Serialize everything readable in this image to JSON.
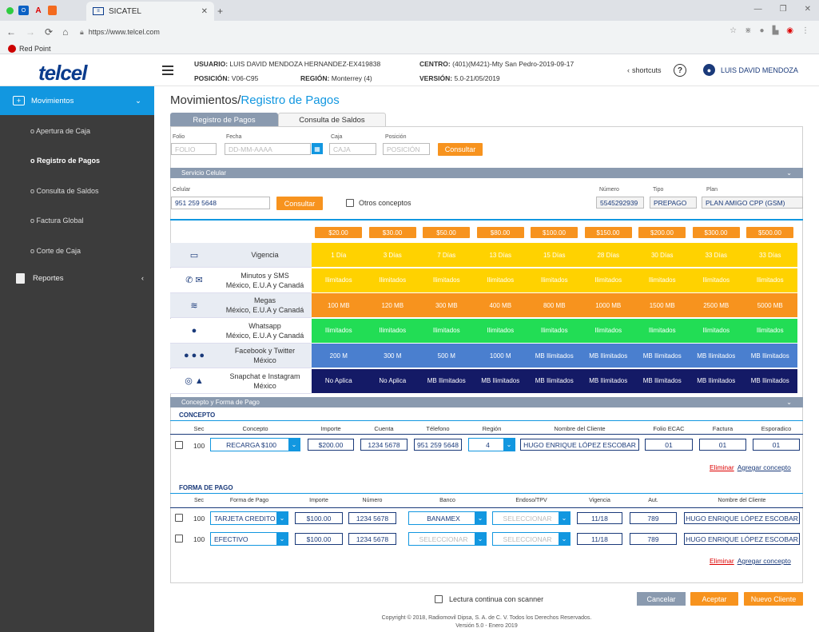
{
  "browser": {
    "tab_title": "SICATEL",
    "url": "https://www.telcel.com",
    "bookmark": "Red Point"
  },
  "header": {
    "logo": "telcel",
    "usuario_label": "USUARIO:",
    "usuario": "LUIS DAVID MENDOZA HERNANDEZ-EX419838",
    "posicion_label": "POSICIÓN:",
    "posicion": "V06-C95",
    "region_label": "REGIÓN:",
    "region": "Monterrey (4)",
    "centro_label": "CENTRO:",
    "centro": "(401)(M421)-Mty San Pedro-2019-09-17",
    "version_label": "VERSIÓN:",
    "version": "5.0-21/05/2019",
    "shortcuts": "shortcuts",
    "user_name": "LUIS DAVID MENDOZA"
  },
  "sidebar": {
    "movimientos": "Movimientos",
    "items": [
      "o Apertura de Caja",
      "o Registro de Pagos",
      "o Consulta de Saldos",
      "o Factura Global",
      "o Corte de Caja"
    ],
    "reportes": "Reportes"
  },
  "page": {
    "title_main": "Movimientos/",
    "title_sub": "Registro de Pagos",
    "tab_registro": "Registro de Pagos",
    "tab_consulta": "Consulta de Saldos"
  },
  "filters": {
    "folio_label": "Folio",
    "folio_ph": "FOLIO",
    "fecha_label": "Fecha",
    "fecha_ph": "DD-MM-AAAA",
    "caja_label": "Caja",
    "caja_ph": "CAJA",
    "posicion_label": "Posición",
    "posicion_ph": "POSICIÓN",
    "consultar": "Consultar"
  },
  "servicio": {
    "title": "Servicio Celular",
    "celular_label": "Celular",
    "celular": "951 259 5648",
    "consultar": "Consultar",
    "otros": "Otros conceptos",
    "numero_label": "Número",
    "numero": "5545292939",
    "tipo_label": "Tipo",
    "tipo": "PREPAGO",
    "plan_label": "Plan",
    "plan": "PLAN AMIGO CPP (GSM)"
  },
  "plans": {
    "prices": [
      "$20.00",
      "$30.00",
      "$50.00",
      "$80.00",
      "$100.00",
      "$150.00",
      "$200.00",
      "$300.00",
      "$500.00"
    ],
    "rows": [
      {
        "label": "Vigencia",
        "label2": "",
        "bg": "#ffd200",
        "fg": "#ffffff",
        "values": [
          "1 Día",
          "3 Días",
          "7 Días",
          "13 Días",
          "15 Días",
          "28 Días",
          "30 Días",
          "33 Días",
          "33 Días"
        ]
      },
      {
        "label": "Minutos y SMS",
        "label2": "México, E.U.A y Canadá",
        "bg": "#ffd200",
        "fg": "#ffffff",
        "values": [
          "Ilimitados",
          "Ilimitados",
          "Ilimitados",
          "Ilimitados",
          "Ilimitados",
          "Ilimitados",
          "Ilimitados",
          "Ilimitados",
          "Ilimitados"
        ]
      },
      {
        "label": "Megas",
        "label2": "México, E.U.A y Canadá",
        "bg": "#f7931e",
        "fg": "#ffffff",
        "values": [
          "100 MB",
          "120 MB",
          "300 MB",
          "400 MB",
          "800 MB",
          "1000 MB",
          "1500 MB",
          "2500 MB",
          "5000 MB"
        ]
      },
      {
        "label": "Whatsapp",
        "label2": "México, E.U.A y Canadá",
        "bg": "#22dd55",
        "fg": "#ffffff",
        "values": [
          "Ilimitados",
          "Ilimitados",
          "Ilimitados",
          "Ilimitados",
          "Ilimitados",
          "Ilimitados",
          "Ilimitados",
          "Ilimitados",
          "Ilimitados"
        ]
      },
      {
        "label": "Facebook y Twitter",
        "label2": "México",
        "bg": "#4a7fcf",
        "fg": "#ffffff",
        "values": [
          "200 M",
          "300 M",
          "500 M",
          "1000 M",
          "MB Ilimitados",
          "MB Ilimitados",
          "MB Ilimitados",
          "MB Ilimitados",
          "MB Ilimitados"
        ]
      },
      {
        "label": "Snapchat e Instagram",
        "label2": "México",
        "bg": "#141a66",
        "fg": "#ffffff",
        "values": [
          "No Aplica",
          "No Aplica",
          "MB Ilimitados",
          "MB Ilimitados",
          "MB Ilimitados",
          "MB Ilimitados",
          "MB Ilimitados",
          "MB Ilimitados",
          "MB Ilimitados"
        ]
      }
    ]
  },
  "concepto": {
    "section_title": "Concepto y Forma de Pago",
    "sub_title": "CONCEPTO",
    "headers": [
      "Sec",
      "Concepto",
      "Importe",
      "Cuenta",
      "Télefono",
      "Región",
      "Nombre del Cliente",
      "Folio ECAC",
      "Factura",
      "Esporadico"
    ],
    "row": {
      "sec": "100",
      "concepto": "RECARGA $100",
      "importe": "$200.00",
      "cuenta": "1234 5678",
      "telefono": "951 259 5648",
      "region": "4",
      "cliente": "HUGO ENRIQUE LÓPEZ ESCOBAR",
      "folio": "01",
      "factura": "01",
      "esporadico": "01"
    },
    "eliminar": "Eliminar",
    "agregar": "Agregar concepto"
  },
  "pago": {
    "sub_title": "FORMA DE PAGO",
    "headers": [
      "Sec",
      "Forma de Pago",
      "Importe",
      "Número",
      "Banco",
      "Endoso/TPV",
      "Vigencia",
      "Aut.",
      "Nombre del Cliente"
    ],
    "rows": [
      {
        "sec": "100",
        "forma": "TARJETA CREDITO",
        "importe": "$100.00",
        "numero": "1234 5678",
        "banco": "BANAMEX",
        "endoso": "SELECCIONAR",
        "vigencia": "11/18",
        "aut": "789",
        "cliente": "HUGO ENRIQUE LÓPEZ ESCOBAR"
      },
      {
        "sec": "100",
        "forma": "EFECTIVO",
        "importe": "$100.00",
        "numero": "1234 5678",
        "banco": "SELECCIONAR",
        "endoso": "SELECCIONAR",
        "vigencia": "11/18",
        "aut": "789",
        "cliente": "HUGO ENRIQUE LÓPEZ ESCOBAR"
      }
    ],
    "eliminar": "Eliminar",
    "agregar": "Agregar concepto"
  },
  "footer": {
    "scanner": "Lectura continua con scanner",
    "cancelar": "Cancelar",
    "aceptar": "Aceptar",
    "nuevo": "Nuevo Cliente",
    "copyright": "Copyright © 2018, Radiomovil Dipsa, S. A. de C. V. Todos los Derechos Reservados.",
    "version": "Versión 5.0 - Enero 2019"
  }
}
